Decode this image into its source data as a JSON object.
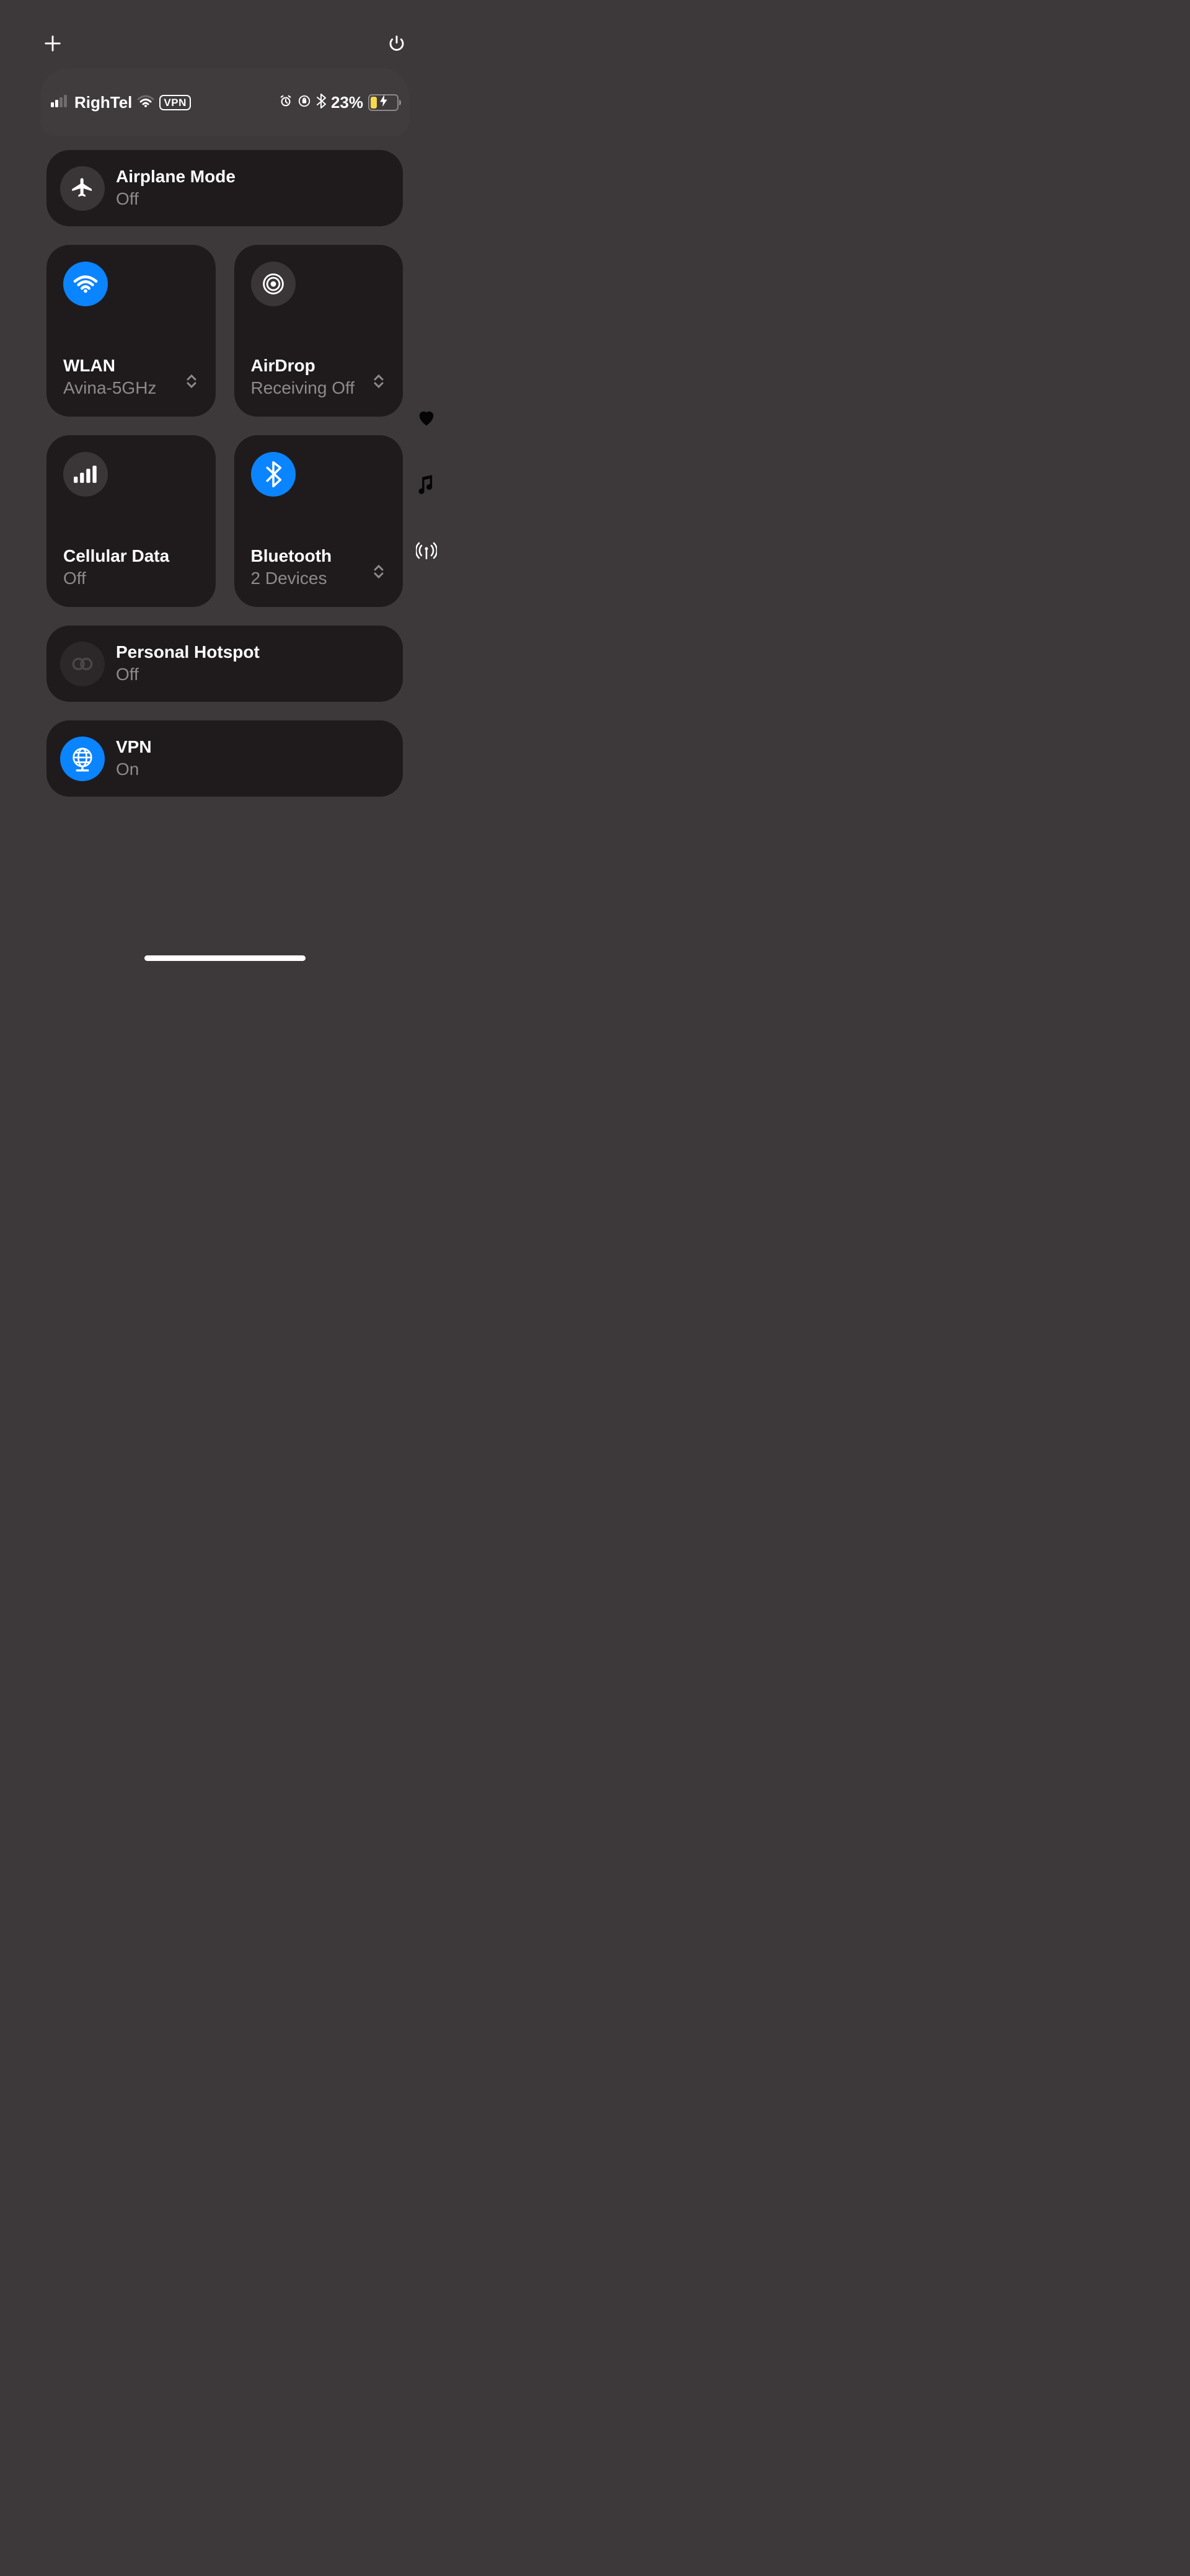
{
  "statusbar": {
    "carrier": "RighTel",
    "vpn_label": "VPN",
    "battery_pct": "23%"
  },
  "tiles": {
    "airplane": {
      "title": "Airplane Mode",
      "subtitle": "Off"
    },
    "wlan": {
      "title": "WLAN",
      "subtitle": "Avina-5GHz"
    },
    "airdrop": {
      "title": "AirDrop",
      "subtitle": "Receiving Off"
    },
    "cellular": {
      "title": "Cellular Data",
      "subtitle": "Off"
    },
    "bluetooth": {
      "title": "Bluetooth",
      "subtitle": "2 Devices"
    },
    "hotspot": {
      "title": "Personal Hotspot",
      "subtitle": "Off"
    },
    "vpn": {
      "title": "VPN",
      "subtitle": "On"
    }
  }
}
